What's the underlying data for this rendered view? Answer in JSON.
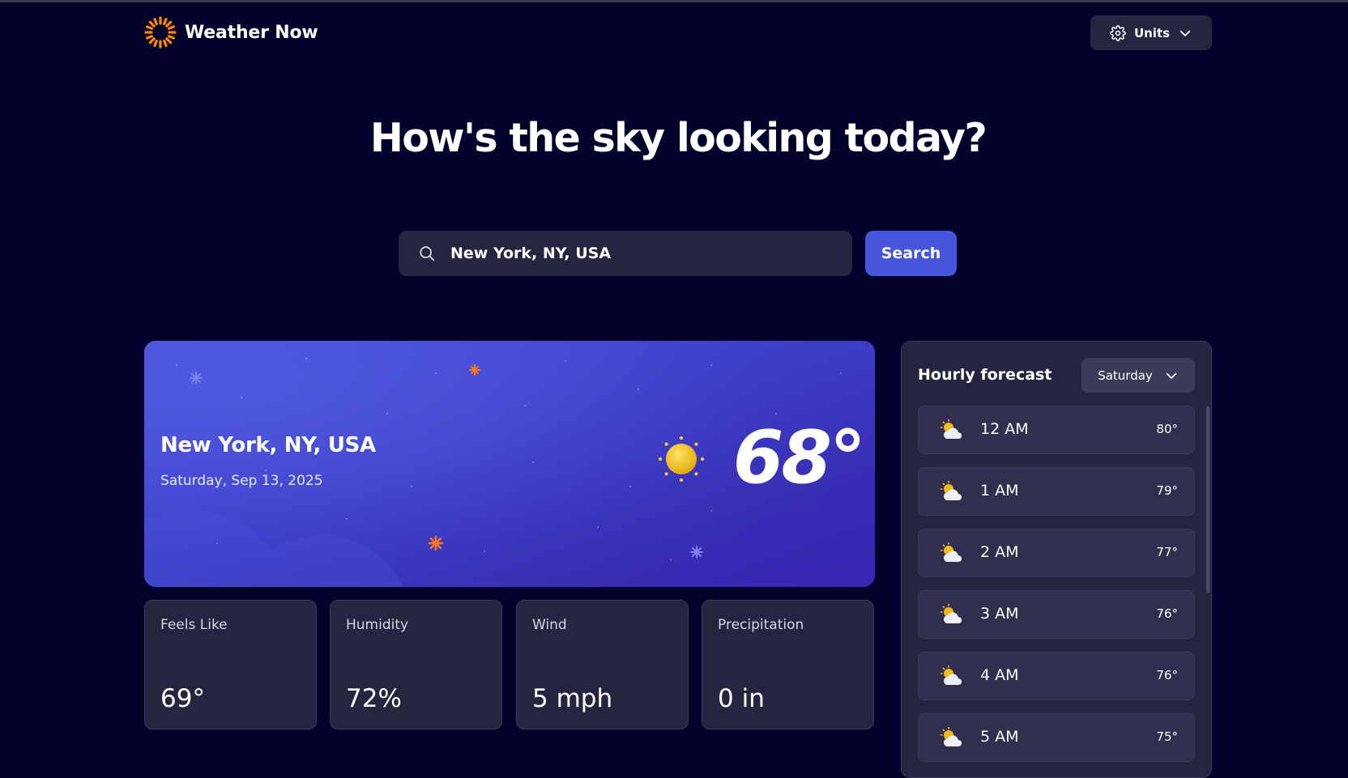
{
  "app": {
    "name": "Weather Now",
    "units_label": "Units"
  },
  "headline": "How's the sky looking today?",
  "search": {
    "value": "New York, NY, USA",
    "button_label": "Search"
  },
  "current": {
    "location": "New York, NY, USA",
    "date": "Saturday, Sep 13, 2025",
    "temperature": "68°",
    "condition_icon": "sunny-icon"
  },
  "stats": [
    {
      "label": "Feels Like",
      "value": "69°"
    },
    {
      "label": "Humidity",
      "value": "72%"
    },
    {
      "label": "Wind",
      "value": "5 mph"
    },
    {
      "label": "Precipitation",
      "value": "0 in"
    }
  ],
  "hourly": {
    "title": "Hourly forecast",
    "selected_day": "Saturday",
    "items": [
      {
        "time": "12 AM",
        "temp": "80°",
        "icon": "partly-cloudy-icon"
      },
      {
        "time": "1 AM",
        "temp": "79°",
        "icon": "partly-cloudy-icon"
      },
      {
        "time": "2 AM",
        "temp": "77°",
        "icon": "partly-cloudy-icon"
      },
      {
        "time": "3 AM",
        "temp": "76°",
        "icon": "partly-cloudy-icon"
      },
      {
        "time": "4 AM",
        "temp": "76°",
        "icon": "partly-cloudy-icon"
      },
      {
        "time": "5 AM",
        "temp": "75°",
        "icon": "partly-cloudy-icon"
      }
    ]
  },
  "colors": {
    "background": "#02012b",
    "card": "#262540",
    "accent": "#4656dc",
    "brand_sun": "#ff8a00"
  }
}
